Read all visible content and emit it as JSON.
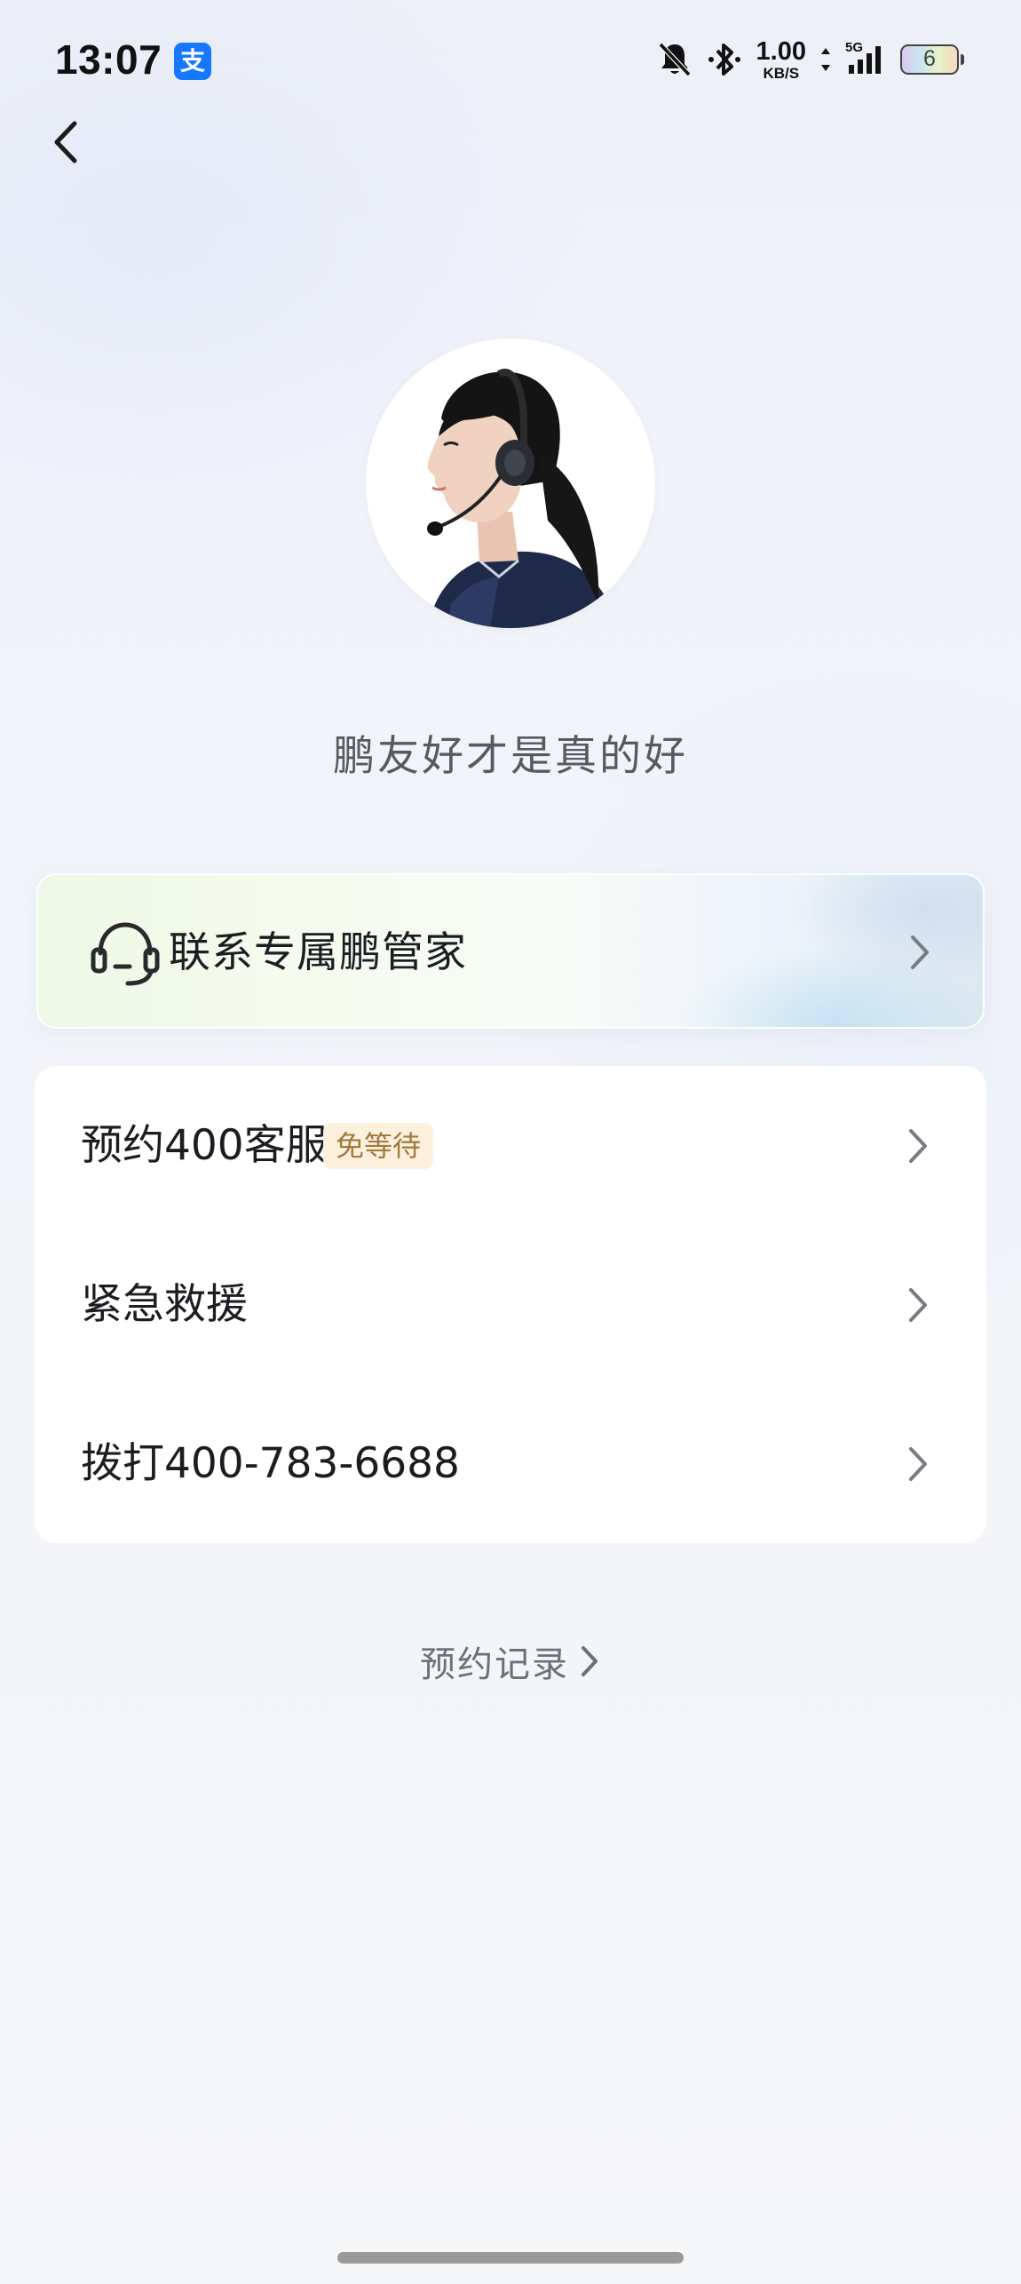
{
  "status_bar": {
    "time": "13:07",
    "app_badge": "支",
    "net_speed_value": "1.00",
    "net_speed_unit": "KB/S",
    "network_type": "5G",
    "battery_level": "6"
  },
  "header": {
    "back_icon": "chevron-left-icon"
  },
  "profile": {
    "slogan": "鹏友好才是真的好"
  },
  "steward": {
    "label": "联系专属鹏管家",
    "icon": "headset-icon"
  },
  "menu": {
    "items": [
      {
        "label": "预约400客服",
        "badge": "免等待"
      },
      {
        "label": "紧急救援"
      },
      {
        "label": "拨打400-783-6688"
      }
    ]
  },
  "records": {
    "label": "预约记录"
  },
  "colors": {
    "badge_bg": "#fdf1de",
    "badge_text": "#a27a3e",
    "alipay_blue": "#1677ff"
  }
}
